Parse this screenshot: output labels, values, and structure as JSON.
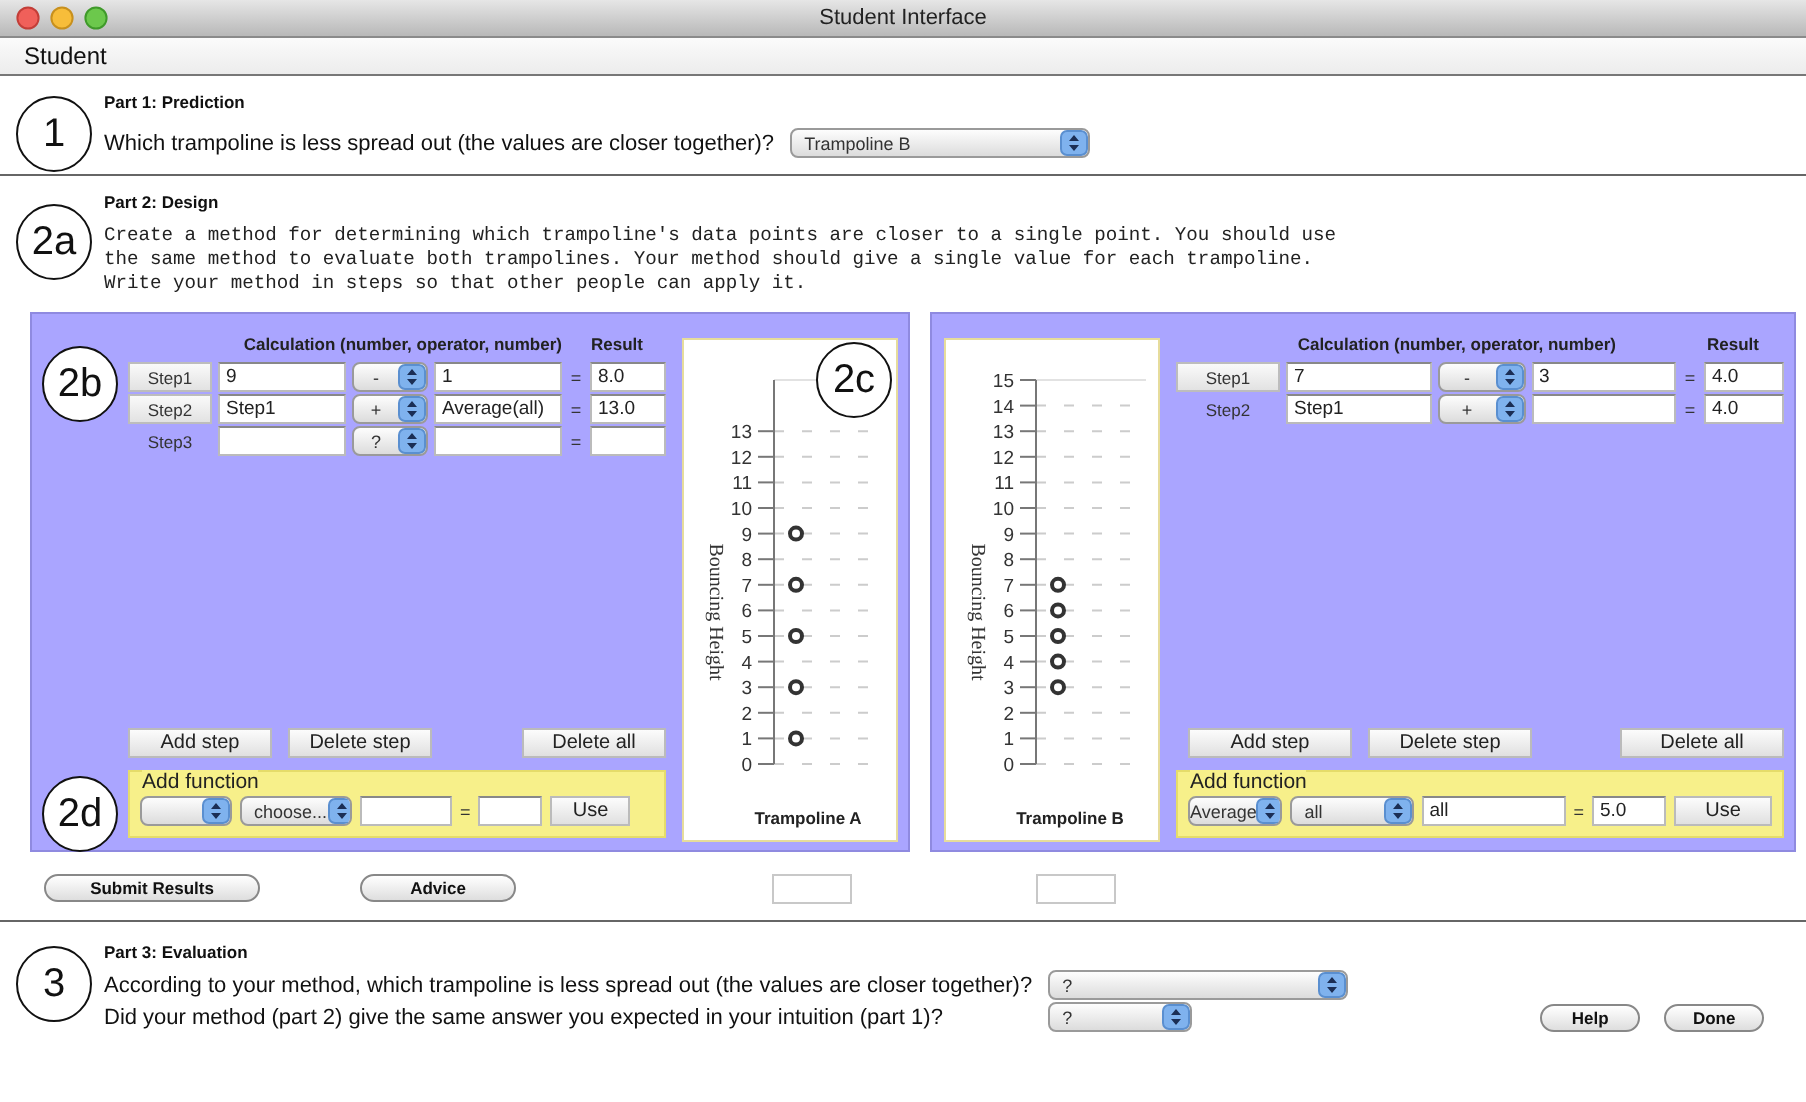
{
  "window": {
    "title": "Student Interface"
  },
  "menu": [
    "Student"
  ],
  "part1": {
    "heading": "Part 1: Prediction",
    "callout": "1",
    "question": "Which trampoline is less spread out (the values are closer together)?",
    "answer": "Trampoline B"
  },
  "part2": {
    "heading": "Part 2: Design",
    "callout": "2a",
    "instructions": "Create a method for determining which trampoline's data points are closer to a single point. You should use\nthe same method to evaluate both trampolines. Your method should give a single value for each trampoline.\nWrite your method in steps so that other people can apply it."
  },
  "panels": [
    {
      "kind": "chart-right",
      "callout_steps": "2b",
      "callout_chart": "2c",
      "calculation_header": "Calculation (number, operator, number)",
      "result_header": "Result",
      "steps": [
        {
          "label": "Step1",
          "selected": true,
          "operand1": "9",
          "operator": "-",
          "operand2": "1",
          "equals": "=",
          "result": "8.0"
        },
        {
          "label": "Step2",
          "selected": true,
          "operand1": "Step1",
          "operator": "+",
          "operand2": "Average(all)",
          "equals": "=",
          "result": "13.0"
        },
        {
          "label": "Step3",
          "selected": false,
          "operator": "?",
          "equals": "="
        }
      ],
      "buttons": [
        "Add step",
        "Delete step",
        "Delete all"
      ],
      "function": {
        "legend": "Add function",
        "callout": "2d",
        "argument": "choose...",
        "equals": "=",
        "button": "Use"
      },
      "chart_data": {
        "type": "scatter",
        "xlabel": "Trampoline A",
        "ylabel": "Bouncing Height",
        "grid": true,
        "categories": [
          null
        ],
        "ylim": [
          0,
          15
        ],
        "yticks": [
          {
            "value": 0,
            "label": "0"
          },
          {
            "value": 1,
            "label": "1"
          },
          {
            "value": 2,
            "label": "2"
          },
          {
            "value": 3,
            "label": "3"
          },
          {
            "value": 4,
            "label": "4"
          },
          {
            "value": 5,
            "label": "5"
          },
          {
            "value": 6,
            "label": "6"
          },
          {
            "value": 7,
            "label": "7"
          },
          {
            "value": 8,
            "label": "8"
          },
          {
            "value": 9,
            "label": "9"
          },
          {
            "value": 10,
            "label": "10"
          },
          {
            "value": 11,
            "label": "11"
          },
          {
            "value": 12,
            "label": "12"
          },
          {
            "value": 13,
            "label": "13"
          }
        ],
        "series": [
          {
            "values": [
              1
            ]
          },
          {
            "values": [
              3
            ]
          },
          {
            "values": [
              5
            ]
          },
          {
            "values": [
              7
            ]
          },
          {
            "values": [
              9
            ]
          }
        ]
      }
    },
    {
      "kind": "chart-left",
      "calculation_header": "Calculation (number, operator, number)",
      "result_header": "Result",
      "steps": [
        {
          "label": "Step1",
          "selected": true,
          "operand1": "7",
          "operator": "-",
          "operand2": "3",
          "equals": "=",
          "result": "4.0"
        },
        {
          "label": "Step2",
          "selected": false,
          "operand1": "Step1",
          "operator": "+",
          "equals": "=",
          "result": "4.0"
        }
      ],
      "buttons": [
        "Add step",
        "Delete step",
        "Delete all"
      ],
      "function": {
        "legend": "Add function",
        "function": "Average",
        "argument": "all",
        "input": "all",
        "equals": "=",
        "result": "5.0",
        "button": "Use"
      },
      "chart_data": {
        "type": "scatter",
        "xlabel": "Trampoline B",
        "ylabel": "Bouncing Height",
        "grid": true,
        "categories": [
          null
        ],
        "ylim": [
          0,
          15
        ],
        "yticks": [
          {
            "value": 0,
            "label": "0"
          },
          {
            "value": 1,
            "label": "1"
          },
          {
            "value": 2,
            "label": "2"
          },
          {
            "value": 3,
            "label": "3"
          },
          {
            "value": 4,
            "label": "4"
          },
          {
            "value": 5,
            "label": "5"
          },
          {
            "value": 6,
            "label": "6"
          },
          {
            "value": 7,
            "label": "7"
          },
          {
            "value": 8,
            "label": "8"
          },
          {
            "value": 9,
            "label": "9"
          },
          {
            "value": 10,
            "label": "10"
          },
          {
            "value": 11,
            "label": "11"
          },
          {
            "value": 12,
            "label": "12"
          },
          {
            "value": 13,
            "label": "13"
          },
          {
            "value": 14,
            "label": "14"
          },
          {
            "value": 15,
            "label": "15"
          }
        ],
        "series": [
          {
            "values": [
              3
            ]
          },
          {
            "values": [
              4
            ]
          },
          {
            "values": [
              5
            ]
          },
          {
            "values": [
              6
            ]
          },
          {
            "values": [
              7
            ]
          }
        ]
      }
    }
  ],
  "actions": [
    "Submit Results",
    "Advice"
  ],
  "part3": {
    "heading": "Part 3: Evaluation",
    "callout": "3",
    "questions": [
      {
        "text": "According to your method, which trampoline is less spread out (the values are closer together)?",
        "answer": "?"
      },
      {
        "text": "Did your method (part 2) give the same answer you expected in your intuition (part 1)?",
        "answer": "?"
      }
    ],
    "buttons": [
      "Help",
      "Done"
    ]
  }
}
